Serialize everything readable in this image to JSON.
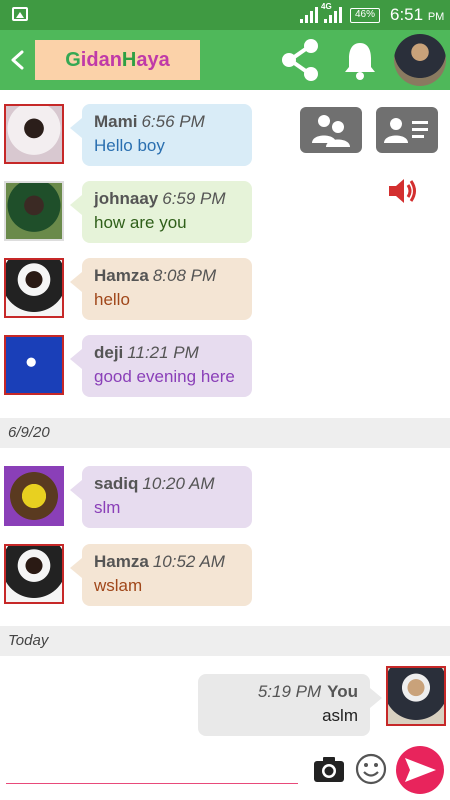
{
  "status_bar": {
    "network": "4G",
    "battery": "46%",
    "time": "6:51",
    "ampm": "PM"
  },
  "header": {
    "logo_g": "G",
    "logo_rest1": "idan ",
    "logo_h": "H",
    "logo_rest2": "aya",
    "icons": [
      "back-icon",
      "share-icon",
      "bell-icon",
      "user-avatar"
    ]
  },
  "messages": [
    {
      "name": "Mami",
      "time": "6:56 PM",
      "text": "Hello boy",
      "color": "#2a6fb0"
    },
    {
      "name": "johnaay",
      "time": "6:59 PM",
      "text": "how are you",
      "color": "#2f5f1a"
    },
    {
      "name": "Hamza",
      "time": "8:08 PM",
      "text": "hello",
      "color": "#a0471a"
    },
    {
      "name": "deji",
      "time": "11:21 PM",
      "text": "good evening here",
      "color": "#8a3fb8"
    }
  ],
  "date_1": "6/9/20",
  "messages_2": [
    {
      "name": "sadiq",
      "time": "10:20 AM",
      "text": "slm",
      "color": "#8a3fb8"
    },
    {
      "name": "Hamza",
      "time": "10:52 AM",
      "text": "wslam",
      "color": "#a0471a"
    }
  ],
  "date_2": "Today",
  "own_message": {
    "time": "5:19 PM",
    "name": "You",
    "text": "aslm"
  },
  "input": {
    "placeholder": ""
  },
  "colors": {
    "primary": "#4fb85a",
    "status": "#3f9a42",
    "accent": "#e8245c"
  }
}
